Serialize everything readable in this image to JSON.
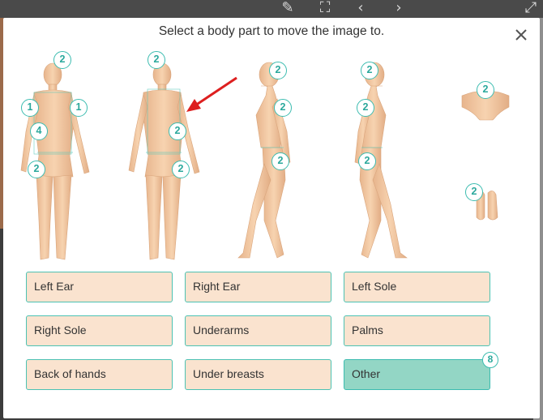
{
  "modal": {
    "title": "Select a body part to move the image to."
  },
  "figure_badges": [
    {
      "id": "front-head",
      "count": "2"
    },
    {
      "id": "front-right-shoulder",
      "count": "1"
    },
    {
      "id": "front-left-shoulder",
      "count": "1"
    },
    {
      "id": "front-chest",
      "count": "4"
    },
    {
      "id": "front-thigh",
      "count": "2"
    },
    {
      "id": "back-head",
      "count": "2"
    },
    {
      "id": "back-arm",
      "count": "2"
    },
    {
      "id": "back-thigh",
      "count": "2"
    },
    {
      "id": "side1-head",
      "count": "2"
    },
    {
      "id": "side1-chest",
      "count": "2"
    },
    {
      "id": "side1-hip",
      "count": "2"
    },
    {
      "id": "side2-head",
      "count": "2"
    },
    {
      "id": "side2-chest",
      "count": "2"
    },
    {
      "id": "side2-hip",
      "count": "2"
    },
    {
      "id": "top-shoulders",
      "count": "2"
    },
    {
      "id": "feet",
      "count": "2"
    }
  ],
  "buttons": [
    {
      "label": "Left Ear"
    },
    {
      "label": "Right Ear"
    },
    {
      "label": "Left Sole"
    },
    {
      "label": "Right Sole"
    },
    {
      "label": "Underarms"
    },
    {
      "label": "Palms"
    },
    {
      "label": "Back of hands"
    },
    {
      "label": "Under breasts"
    },
    {
      "label": "Other",
      "selected": true,
      "count": "8"
    }
  ],
  "colors": {
    "accent": "#3cbcb0",
    "button_bg": "#fae3cf",
    "selected_bg": "#93d6c5",
    "skin": "#f3c9a2",
    "arrow": "#dd1f1f"
  },
  "icons": {
    "close": "close-icon",
    "toolbar": [
      "brush-icon",
      "fullscreen-icon",
      "chevron-left-icon",
      "chevron-right-icon",
      "expand-icon"
    ]
  }
}
